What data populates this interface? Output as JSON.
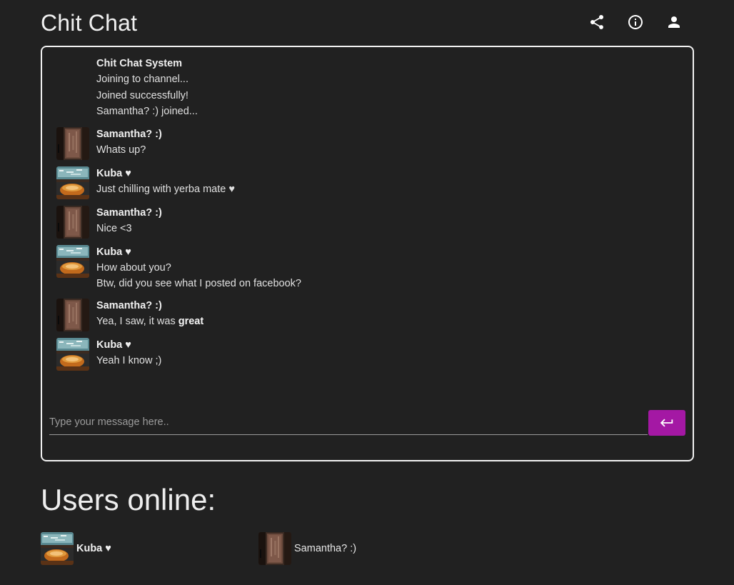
{
  "app": {
    "title": "Chit Chat"
  },
  "header": {
    "icons": [
      "share-icon",
      "info-icon",
      "account-icon"
    ]
  },
  "chat": {
    "system": {
      "author": "Chit Chat System",
      "lines": [
        "Joining to channel...",
        "Joined successfully!",
        "Samantha? :) joined..."
      ]
    },
    "messages": [
      {
        "author": "Samantha? :)",
        "avatar": "samantha",
        "lines": [
          "Whats up?"
        ]
      },
      {
        "author": "Kuba ♥",
        "avatar": "kuba",
        "lines": [
          "Just chilling with yerba mate ♥"
        ]
      },
      {
        "author": "Samantha? :)",
        "avatar": "samantha",
        "lines": [
          "Nice <3"
        ]
      },
      {
        "author": "Kuba ♥",
        "avatar": "kuba",
        "lines": [
          "How about you?",
          "Btw, did you see what I posted on facebook?"
        ]
      },
      {
        "author": "Samantha? :)",
        "avatar": "samantha",
        "line_plain": "Yea, I saw, it was ",
        "line_bold": "great"
      },
      {
        "author": "Kuba ♥",
        "avatar": "kuba",
        "lines": [
          "Yeah I know ;)"
        ]
      }
    ],
    "input": {
      "placeholder": "Type your message here..",
      "value": ""
    },
    "send_icon": "enter-icon"
  },
  "users": {
    "title": "Users online:",
    "list": [
      {
        "name": "Kuba ♥",
        "avatar": "kuba"
      },
      {
        "name": "Samantha? :)",
        "avatar": "samantha"
      }
    ]
  },
  "colors": {
    "background": "#212121",
    "accent": "#a418a4",
    "border": "#f2f2f2"
  }
}
